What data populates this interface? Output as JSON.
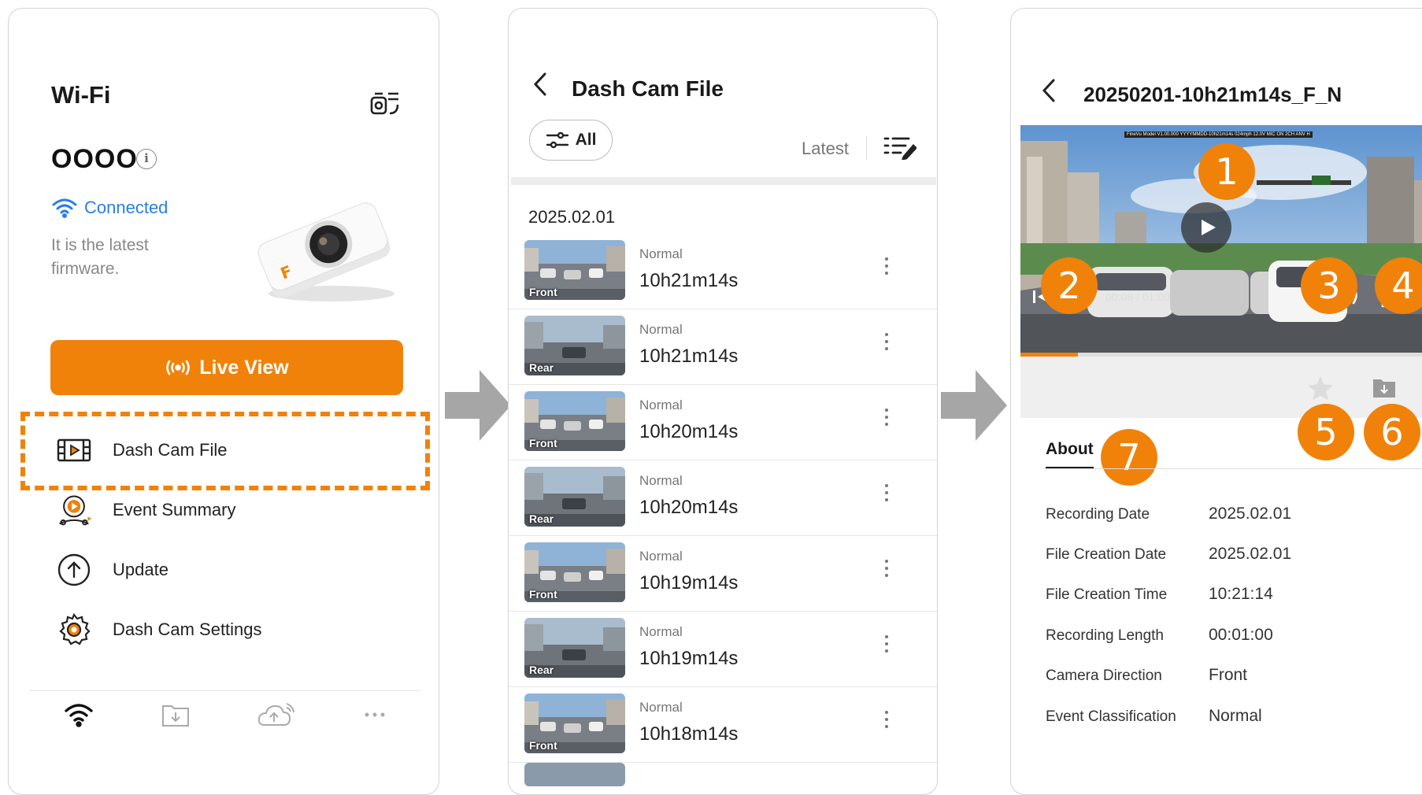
{
  "panel1": {
    "title": "Wi-Fi",
    "device_name": "OOOO",
    "info_glyph": "i",
    "status": "Connected",
    "firmware": "It is the latest firmware.",
    "live_view_label": "Live View",
    "menu": [
      {
        "label": "Dash Cam File",
        "icon": "film-icon"
      },
      {
        "label": "Event Summary",
        "icon": "event-summary-icon"
      },
      {
        "label": "Update",
        "icon": "upload-arrow-icon"
      },
      {
        "label": "Dash Cam Settings",
        "icon": "gear-icon"
      }
    ],
    "bottom_nav": [
      "wifi-icon",
      "download-folder-icon",
      "cloud-upload-icon",
      "more-icon"
    ],
    "accent_color": "#f0820a",
    "status_color": "#2b7de9"
  },
  "panel2": {
    "title": "Dash Cam File",
    "filter_label": "All",
    "sort_label": "Latest",
    "date_header": "2025.02.01",
    "files": [
      {
        "camera": "Front",
        "type": "Normal",
        "time": "10h21m14s"
      },
      {
        "camera": "Rear",
        "type": "Normal",
        "time": "10h21m14s"
      },
      {
        "camera": "Front",
        "type": "Normal",
        "time": "10h20m14s"
      },
      {
        "camera": "Rear",
        "type": "Normal",
        "time": "10h20m14s"
      },
      {
        "camera": "Front",
        "type": "Normal",
        "time": "10h19m14s"
      },
      {
        "camera": "Rear",
        "type": "Normal",
        "time": "10h19m14s"
      },
      {
        "camera": "Front",
        "type": "Normal",
        "time": "10h18m14s"
      }
    ]
  },
  "panel3": {
    "title": "20250201-10h21m14s_F_N",
    "video_overlay": "FineVu Model V1.00.000 YYYYMMDD-10h21m14s 024mph 12.0V MIC ON 2CH ANV H",
    "current_time": "00:08",
    "total_time": "01:00",
    "progress": 0.133,
    "badges": [
      "1",
      "2",
      "3",
      "4",
      "5",
      "6",
      "7"
    ],
    "about_tab": "About",
    "info": [
      {
        "label": "Recording Date",
        "value": "2025.02.01"
      },
      {
        "label": "File Creation Date",
        "value": "2025.02.01"
      },
      {
        "label": "File Creation Time",
        "value": "10:21:14"
      },
      {
        "label": "Recording Length",
        "value": "00:01:00"
      },
      {
        "label": "Camera Direction",
        "value": "Front"
      },
      {
        "label": "Event Classification",
        "value": "Normal"
      }
    ]
  }
}
